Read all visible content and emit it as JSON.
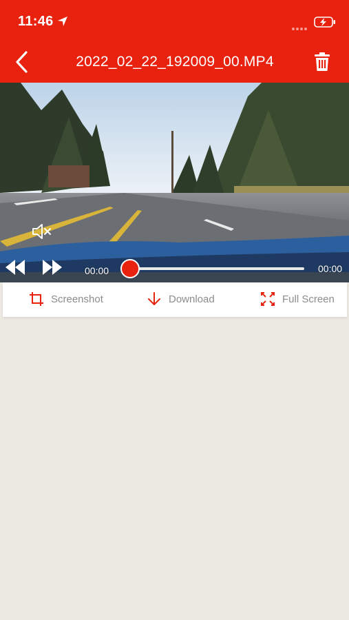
{
  "status_bar": {
    "time": "11:46"
  },
  "header": {
    "title": "2022_02_22_192009_00.MP4"
  },
  "player": {
    "current_time": "00:00",
    "total_time": "00:00",
    "progress": 0
  },
  "actions": {
    "screenshot_label": "Screenshot",
    "download_label": "Download",
    "fullscreen_label": "Full Screen"
  },
  "colors": {
    "accent": "#e8220f",
    "page_background": "#ece9e2",
    "action_text": "#8b8b8b"
  },
  "icons": [
    "location-arrow-icon",
    "signal-icon",
    "battery-charging-icon",
    "back-chevron-icon",
    "trash-icon",
    "mute-icon",
    "rewind-icon",
    "fast-forward-icon",
    "crop-icon",
    "download-arrow-icon",
    "fullscreen-icon"
  ]
}
